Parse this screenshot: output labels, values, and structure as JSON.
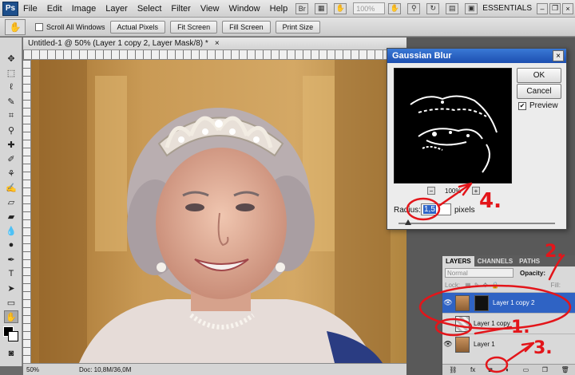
{
  "menubar": {
    "logo": "Ps",
    "items": [
      "File",
      "Edit",
      "Image",
      "Layer",
      "Select",
      "Filter",
      "View",
      "Window",
      "Help"
    ],
    "zoom_value": "100%",
    "workspace": "ESSENTIALS"
  },
  "options_bar": {
    "scroll_all_windows": "Scroll All Windows",
    "buttons": [
      "Actual Pixels",
      "Fit Screen",
      "Fill Screen",
      "Print Size"
    ]
  },
  "document": {
    "tab_title": "Untitled-1 @ 50% (Layer 1 copy 2, Layer Mask/8) *",
    "close_glyph": "×",
    "status_zoom": "50%",
    "status_doc": "Doc: 10,8M/36,0M"
  },
  "dialog": {
    "title": "Gaussian Blur",
    "ok_label": "OK",
    "cancel_label": "Cancel",
    "preview_label": "Preview",
    "preview_checked": true,
    "zoom_pct": "100%",
    "radius_label": "Radius:",
    "radius_value": "1,5",
    "radius_unit": "pixels"
  },
  "layers_panel": {
    "tabs": [
      "LAYERS",
      "CHANNELS",
      "PATHS"
    ],
    "blend_mode": "Normal",
    "opacity_label": "Opacity:",
    "lock_label": "Lock:",
    "fill_label": "Fill:",
    "layers": [
      {
        "name": "Layer 1 copy 2",
        "selected": true,
        "visible": true,
        "has_mask": true
      },
      {
        "name": "Layer 1 copy",
        "selected": false,
        "visible": false,
        "has_mask": false
      },
      {
        "name": "Layer 1",
        "selected": false,
        "visible": true,
        "has_mask": false
      }
    ]
  },
  "annotations": {
    "step1": "1.",
    "step2": "2.",
    "step3": "3.",
    "step4": "4.",
    "color": "#e3151a"
  }
}
